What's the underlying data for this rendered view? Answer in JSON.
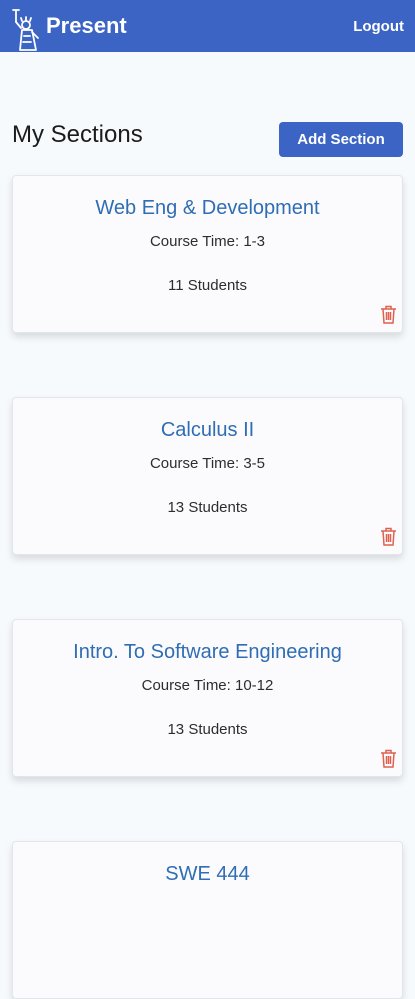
{
  "app": {
    "brand": "Present",
    "logout_label": "Logout"
  },
  "page": {
    "heading": "My Sections",
    "add_section_label": "Add Section"
  },
  "sections": [
    {
      "title": "Web Eng & Development",
      "course_time": "Course Time: 1-3",
      "students": "11 Students"
    },
    {
      "title": "Calculus II",
      "course_time": "Course Time: 3-5",
      "students": "13 Students"
    },
    {
      "title": "Intro. To Software Engineering",
      "course_time": "Course Time: 10-12",
      "students": "13 Students"
    },
    {
      "title": "SWE 444",
      "course_time": "",
      "students": ""
    }
  ],
  "icons": {
    "logo": "statue-of-liberty-icon",
    "delete": "trash-icon"
  },
  "colors": {
    "primary": "#3b64c5",
    "title_link": "#2f6db4",
    "delete": "#e0604f",
    "background": "#f7fafd"
  }
}
